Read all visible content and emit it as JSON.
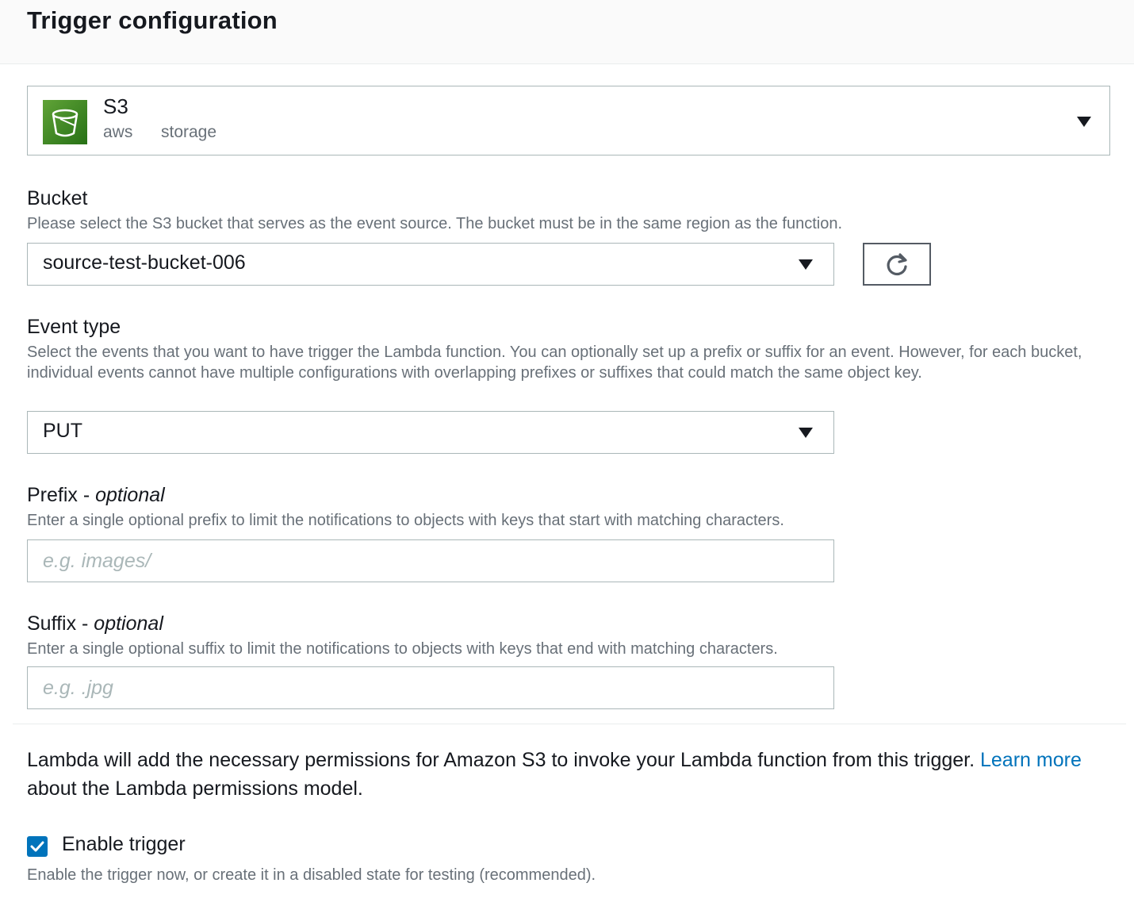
{
  "header": {
    "title": "Trigger configuration"
  },
  "service": {
    "name": "S3",
    "tags": [
      "aws",
      "storage"
    ],
    "icon": "s3-bucket-icon"
  },
  "bucket": {
    "label": "Bucket",
    "description": "Please select the S3 bucket that serves as the event source. The bucket must be in the same region as the function.",
    "value": "source-test-bucket-006",
    "refresh_icon": "refresh-icon"
  },
  "event_type": {
    "label": "Event type",
    "description": "Select the events that you want to have trigger the Lambda function. You can optionally set up a prefix or suffix for an event. However, for each bucket, individual events cannot have multiple configurations with overlapping prefixes or suffixes that could match the same object key.",
    "value": "PUT"
  },
  "prefix": {
    "label": "Prefix",
    "label_suffix": "optional",
    "description": "Enter a single optional prefix to limit the notifications to objects with keys that start with matching characters.",
    "value": "",
    "placeholder": "e.g. images/"
  },
  "suffix": {
    "label": "Suffix",
    "label_suffix": "optional",
    "description": "Enter a single optional suffix to limit the notifications to objects with keys that end with matching characters.",
    "value": "",
    "placeholder": "e.g. .jpg"
  },
  "permissions": {
    "text_before": "Lambda will add the necessary permissions for Amazon S3 to invoke your Lambda function from this trigger. ",
    "link_text": "Learn more",
    "text_after": " about the Lambda permissions model."
  },
  "enable_trigger": {
    "label": "Enable trigger",
    "checked": true,
    "description": "Enable the trigger now, or create it in a disabled state for testing (recommended)."
  },
  "colors": {
    "accent": "#0073bb",
    "s3_icon": "#3f8624",
    "border": "#aab7b8",
    "muted_text": "#687078"
  }
}
